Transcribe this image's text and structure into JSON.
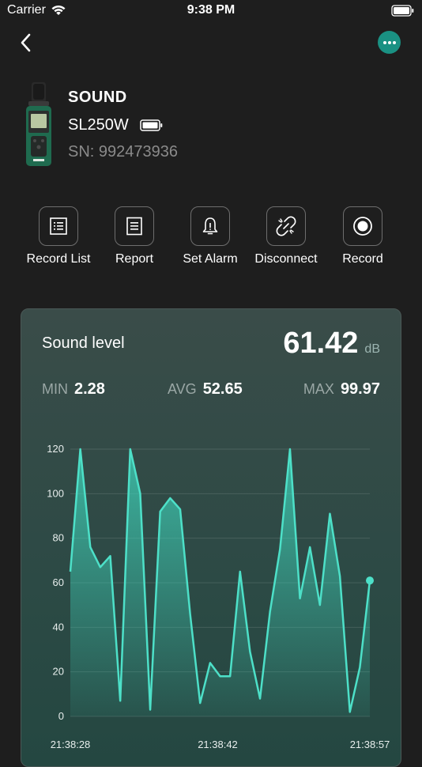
{
  "status_bar": {
    "carrier": "Carrier",
    "time": "9:38 PM"
  },
  "nav": {
    "back_icon": "chevron-left-icon",
    "more_icon": "more-horizontal-icon",
    "accent_color": "#1a9183"
  },
  "device": {
    "type": "SOUND",
    "model": "SL250W",
    "serial": "SN: 992473936",
    "battery_icon": "battery-full-icon"
  },
  "actions": [
    {
      "label": "Record List",
      "icon": "list-icon"
    },
    {
      "label": "Report",
      "icon": "document-icon"
    },
    {
      "label": "Set Alarm",
      "icon": "bell-icon"
    },
    {
      "label": "Disconnect",
      "icon": "broken-link-icon"
    },
    {
      "label": "Record",
      "icon": "record-icon"
    }
  ],
  "card": {
    "title": "Sound level",
    "value": "61.42",
    "unit": "dB",
    "min_label": "MIN",
    "min_value": "2.28",
    "avg_label": "AVG",
    "avg_value": "52.65",
    "max_label": "MAX",
    "max_value": "99.97"
  },
  "chart_data": {
    "type": "area",
    "title": "",
    "xlabel": "",
    "ylabel": "",
    "ylim": [
      0,
      120
    ],
    "y_ticks": [
      0,
      20,
      40,
      60,
      80,
      100,
      120
    ],
    "x_tick_labels": [
      "21:38:28",
      "21:38:42",
      "21:38:57"
    ],
    "grid": true,
    "line_color": "#4de0c8",
    "series": [
      {
        "values": [
          65,
          120,
          76,
          67,
          72,
          7,
          120,
          100,
          3,
          92,
          98,
          93,
          46,
          6,
          24,
          18,
          18,
          65,
          29,
          8,
          47,
          75,
          120,
          53,
          76,
          50,
          91,
          63,
          2,
          22,
          61
        ]
      }
    ]
  }
}
